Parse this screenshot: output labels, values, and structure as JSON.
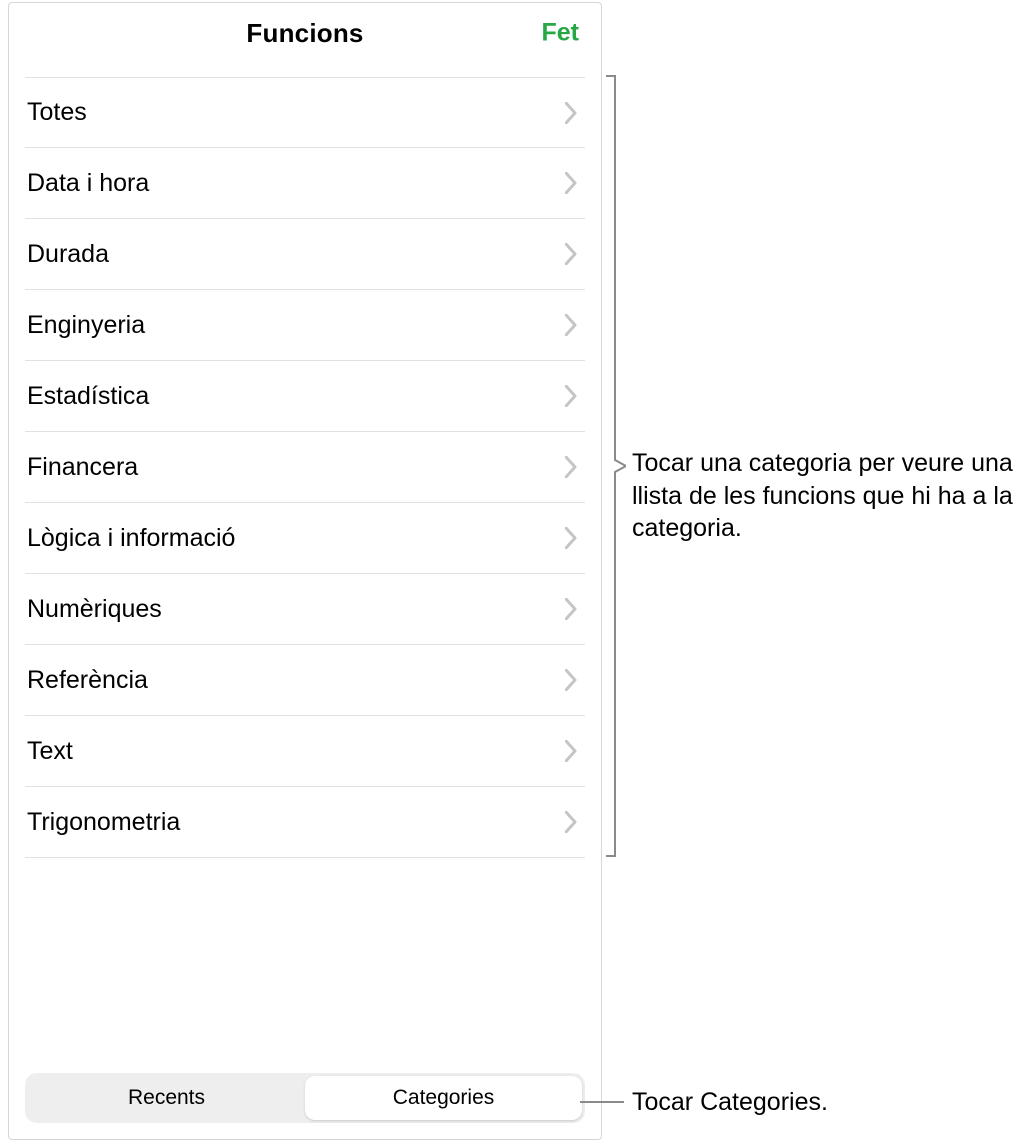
{
  "header": {
    "title": "Funcions",
    "done_label": "Fet"
  },
  "categories": [
    {
      "label": "Totes"
    },
    {
      "label": "Data i hora"
    },
    {
      "label": "Durada"
    },
    {
      "label": "Enginyeria"
    },
    {
      "label": "Estadística"
    },
    {
      "label": "Financera"
    },
    {
      "label": "Lògica i informació"
    },
    {
      "label": "Numèriques"
    },
    {
      "label": "Referència"
    },
    {
      "label": "Text"
    },
    {
      "label": "Trigonometria"
    }
  ],
  "tabs": {
    "recents": "Recents",
    "categories": "Categories"
  },
  "annotations": {
    "category_hint": "Tocar una categoria per veure una llista de les funcions que hi ha a la categoria.",
    "categories_tab_hint": "Tocar Categories."
  },
  "colors": {
    "accent": "#27a744",
    "divider": "#e1e1e1",
    "chevron": "#c5c5c7"
  }
}
